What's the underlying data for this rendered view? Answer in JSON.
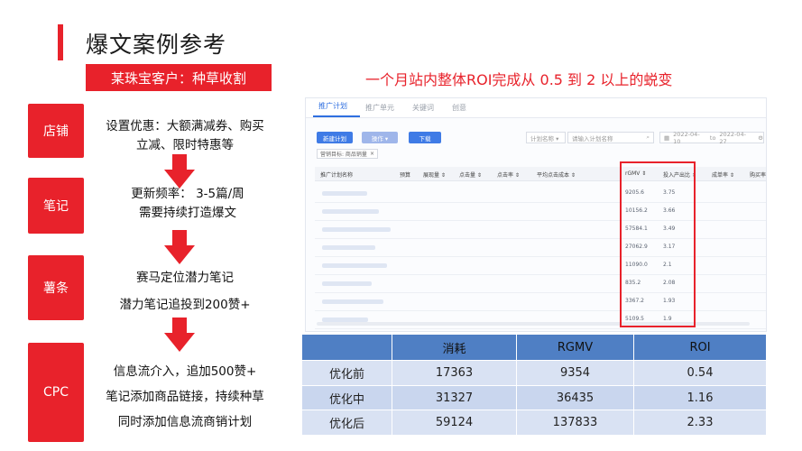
{
  "page": {
    "title": "爆文案例参考",
    "subtitle": "某珠宝客户：种草收割",
    "headline": "一个月站内整体ROI完成从 0.5 到 2 以上的蜕变"
  },
  "stages": [
    {
      "label": "店铺",
      "lines": [
        "设置优惠：大额满减券、购买",
        "立减、限时特惠等"
      ]
    },
    {
      "label": "笔记",
      "lines": [
        "更新频率：   3-5篇/周",
        "需要持续打造爆文"
      ]
    },
    {
      "label": "薯条",
      "lines": [
        "赛马定位潜力笔记",
        "潜力笔记追投到200赞+"
      ]
    },
    {
      "label": "CPC",
      "lines": [
        "信息流介入，追加500赞+",
        "笔记添加商品链接，持续种草",
        "同时添加信息流商销计划"
      ]
    }
  ],
  "dashboard": {
    "tabs": [
      "推广计划",
      "推广单元",
      "关键词",
      "创意"
    ],
    "buttons": {
      "new_plan": "新建计划",
      "action": "操作 ▾",
      "download": "下载"
    },
    "filter_label": "计划名称 ▾",
    "search_placeholder": "请输入计划名称",
    "date_start": "2022-04-10",
    "date_to": "to",
    "date_end": "2022-04-27",
    "tag": "营销目标: 商品销量",
    "columns": [
      "推广计划名称",
      "预算",
      "展现量 ⇕",
      "点击量 ⇕",
      "点击率 ⇕",
      "平均点击成本 ⇕",
      "rGMV ⇕",
      "投入产出比 ⇕",
      "成单率 ⇕",
      "购买率"
    ],
    "rgmv": [
      "9205.6",
      "10156.2",
      "57584.1",
      "27062.9",
      "11090.0",
      "835.2",
      "3367.2",
      "5109.5"
    ],
    "roi": [
      "3.75",
      "3.66",
      "3.49",
      "3.17",
      "2.1",
      "2.08",
      "1.93",
      "1.9"
    ]
  },
  "comparison": {
    "headers": [
      "",
      "消耗",
      "RGMV",
      "ROI"
    ],
    "rows": [
      {
        "label": "优化前",
        "cost": "17363",
        "rgmv": "9354",
        "roi": "0.54"
      },
      {
        "label": "优化中",
        "cost": "31327",
        "rgmv": "36435",
        "roi": "1.16"
      },
      {
        "label": "优化后",
        "cost": "59124",
        "rgmv": "137833",
        "roi": "2.33"
      }
    ]
  },
  "colors": {
    "accent": "#e8222b",
    "table_header": "#4f7fc4",
    "table_row": "#d9e2f3",
    "link_blue": "#2f6fe0"
  }
}
